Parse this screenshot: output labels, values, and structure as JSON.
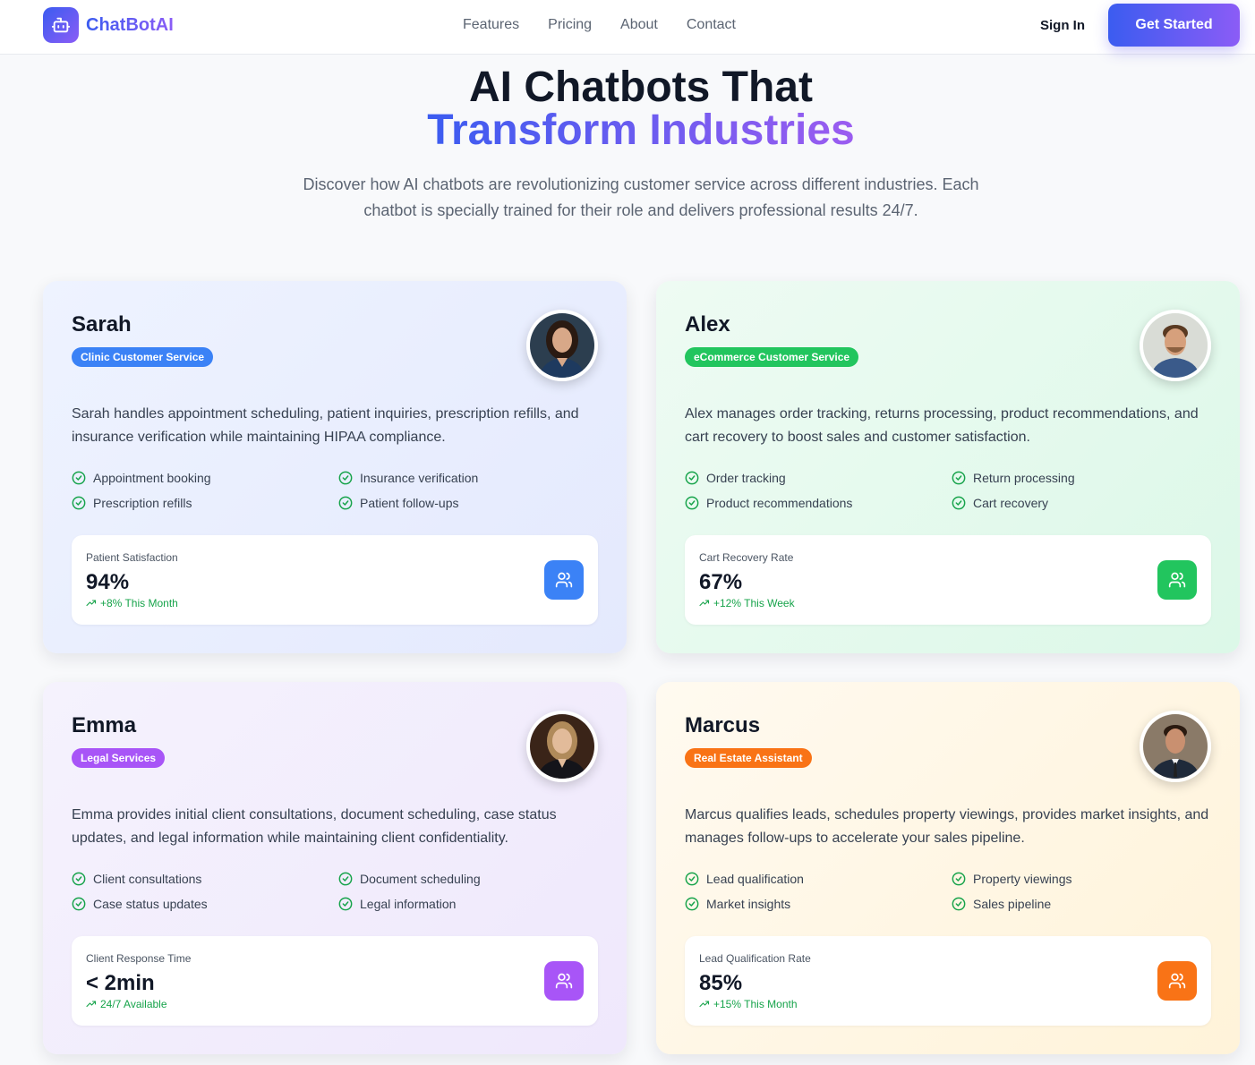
{
  "brand": {
    "name": "ChatBotAI",
    "icon": "robot-icon"
  },
  "nav": {
    "links": [
      "Features",
      "Pricing",
      "About",
      "Contact"
    ],
    "sign_in": "Sign In",
    "cta": "Get Started"
  },
  "hero": {
    "title_line1": "AI Chatbots That",
    "title_line2": "Transform Industries",
    "subtitle": "Discover how AI chatbots are revolutionizing customer service across different industries. Each chatbot is specially trained for their role and delivers professional results 24/7."
  },
  "colors": {
    "accent_start": "#3b5cf0",
    "accent_end": "#8b5cf6",
    "check_green": "#16a34a",
    "sarah_badge": "#3b82f6",
    "alex_badge": "#22c55e",
    "emma_badge": "#a855f7",
    "marcus_badge": "#f97316"
  },
  "cards": [
    {
      "name": "Sarah",
      "badge": "Clinic Customer Service",
      "description": "Sarah handles appointment scheduling, patient inquiries, prescription refills, and insurance verification while maintaining HIPAA compliance.",
      "features": [
        "Appointment booking",
        "Insurance verification",
        "Prescription refills",
        "Patient follow-ups"
      ],
      "stat": {
        "label": "Patient Satisfaction",
        "value": "94%",
        "trend": "+8% This Month",
        "icon": "users-icon"
      }
    },
    {
      "name": "Alex",
      "badge": "eCommerce Customer Service",
      "description": "Alex manages order tracking, returns processing, product recommendations, and cart recovery to boost sales and customer satisfaction.",
      "features": [
        "Order tracking",
        "Return processing",
        "Product recommendations",
        "Cart recovery"
      ],
      "stat": {
        "label": "Cart Recovery Rate",
        "value": "67%",
        "trend": "+12% This Week",
        "icon": "users-icon"
      }
    },
    {
      "name": "Emma",
      "badge": "Legal Services",
      "description": "Emma provides initial client consultations, document scheduling, case status updates, and legal information while maintaining client confidentiality.",
      "features": [
        "Client consultations",
        "Document scheduling",
        "Case status updates",
        "Legal information"
      ],
      "stat": {
        "label": "Client Response Time",
        "value": "< 2min",
        "trend": "24/7 Available",
        "icon": "users-icon"
      }
    },
    {
      "name": "Marcus",
      "badge": "Real Estate Assistant",
      "description": "Marcus qualifies leads, schedules property viewings, provides market insights, and manages follow-ups to accelerate your sales pipeline.",
      "features": [
        "Lead qualification",
        "Property viewings",
        "Market insights",
        "Sales pipeline"
      ],
      "stat": {
        "label": "Lead Qualification Rate",
        "value": "85%",
        "trend": "+15% This Month",
        "icon": "users-icon"
      }
    }
  ]
}
